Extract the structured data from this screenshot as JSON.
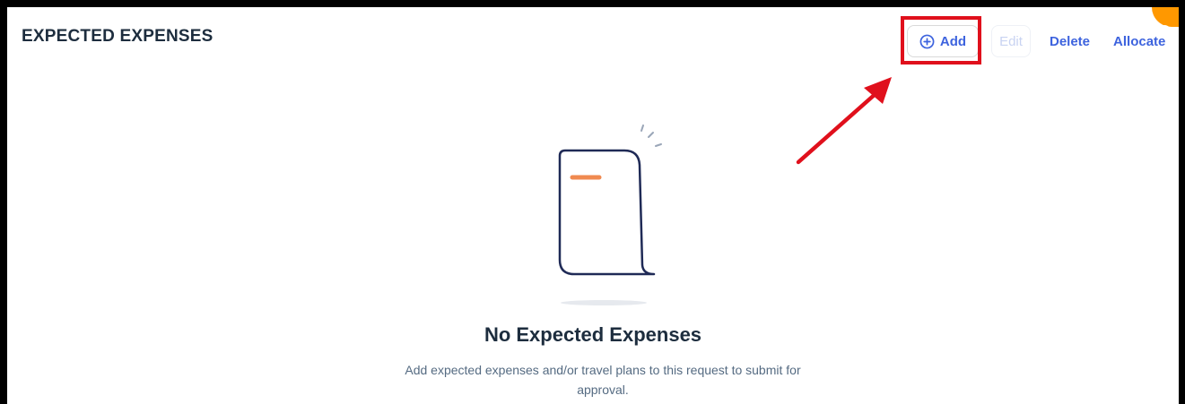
{
  "header": {
    "title": "EXPECTED EXPENSES"
  },
  "toolbar": {
    "add_label": "Add",
    "add_icon": "plus-circle-icon",
    "edit_label": "Edit",
    "edit_disabled": true,
    "delete_label": "Delete",
    "allocate_label": "Allocate"
  },
  "empty_state": {
    "illustration": "empty-document-icon",
    "title": "No Expected Expenses",
    "description": "Add expected expenses and/or travel plans to this request to submit for approval."
  },
  "annotation": {
    "highlight_color": "#e0101c",
    "target": "add-button"
  },
  "colors": {
    "accent": "#3d63de",
    "illustration_stroke": "#1f2a56",
    "illustration_accent": "#f08a50",
    "corner_accent": "#ff9800"
  }
}
